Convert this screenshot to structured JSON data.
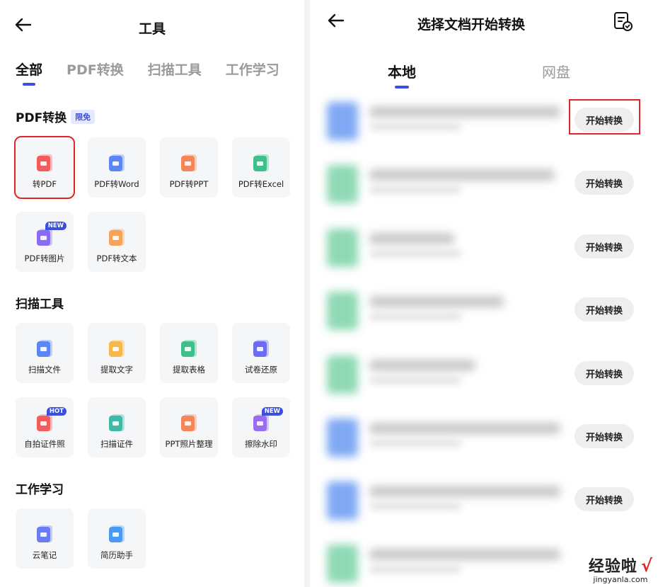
{
  "left": {
    "title": "工具",
    "tabs": [
      "全部",
      "PDF转换",
      "扫描工具",
      "工作学习"
    ],
    "sections": {
      "pdf": {
        "title": "PDF转换",
        "badge": "限免",
        "tools": [
          {
            "label": "转PDF",
            "icon": "pdf-file-icon",
            "color": "#f25c5c"
          },
          {
            "label": "PDF转Word",
            "icon": "word-file-icon",
            "color": "#5b86f3"
          },
          {
            "label": "PDF转PPT",
            "icon": "ppt-file-icon",
            "color": "#f2875c"
          },
          {
            "label": "PDF转Excel",
            "icon": "excel-file-icon",
            "color": "#3fc08a"
          },
          {
            "label": "PDF转图片",
            "icon": "image-file-icon",
            "color": "#8a6cf2",
            "tag": "NEW"
          },
          {
            "label": "PDF转文本",
            "icon": "text-file-icon",
            "color": "#f5a25a"
          }
        ]
      },
      "scan": {
        "title": "扫描工具",
        "tools": [
          {
            "label": "扫描文件",
            "icon": "scan-file-icon",
            "color": "#5b86f3"
          },
          {
            "label": "提取文字",
            "icon": "extract-text-icon",
            "color": "#f5b84a"
          },
          {
            "label": "提取表格",
            "icon": "extract-table-icon",
            "color": "#3fc08a"
          },
          {
            "label": "试卷还原",
            "icon": "exam-restore-icon",
            "color": "#6b6cf2"
          },
          {
            "label": "自拍证件照",
            "icon": "id-photo-icon",
            "color": "#f25c5c",
            "tag": "HOT"
          },
          {
            "label": "扫描证件",
            "icon": "scan-id-icon",
            "color": "#3fb8a6"
          },
          {
            "label": "PPT照片整理",
            "icon": "ppt-photo-icon",
            "color": "#f2875c"
          },
          {
            "label": "擦除水印",
            "icon": "erase-watermark-icon",
            "color": "#9a6cf2",
            "tag": "NEW"
          }
        ]
      },
      "work": {
        "title": "工作学习",
        "tools": [
          {
            "label": "云笔记",
            "icon": "cloud-note-icon",
            "color": "#6b7cf2"
          },
          {
            "label": "简历助手",
            "icon": "resume-icon",
            "color": "#4a9af5"
          }
        ]
      }
    }
  },
  "right": {
    "title": "选择文档开始转换",
    "tabs": [
      "本地",
      "网盘"
    ],
    "button_label": "开始转换",
    "files": [
      {
        "thumb": "blue"
      },
      {
        "thumb": "green"
      },
      {
        "thumb": "green"
      },
      {
        "thumb": "green"
      },
      {
        "thumb": "green"
      },
      {
        "thumb": "blue"
      },
      {
        "thumb": "blue"
      },
      {
        "thumb": "green"
      }
    ]
  },
  "watermark": {
    "main": "经验啦",
    "check": "√",
    "url": "jingyanla.com"
  }
}
